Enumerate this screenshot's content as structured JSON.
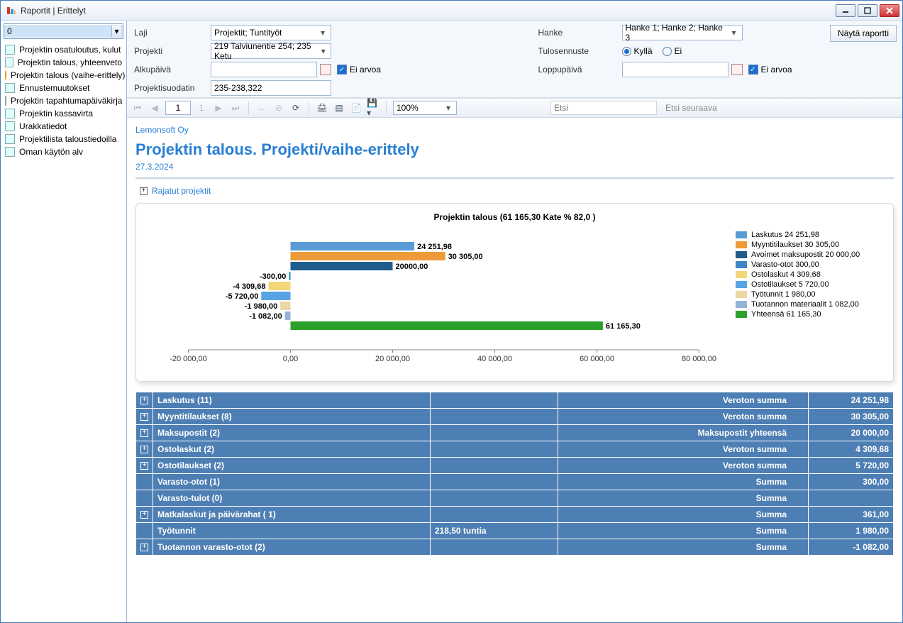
{
  "window": {
    "title": "Raportit | Erittelyt"
  },
  "sidebar": {
    "filter_value": "0",
    "items": [
      {
        "label": "Projektin osatuloutus, kulut",
        "sel": false,
        "ic": "doc"
      },
      {
        "label": "Projektin talous, yhteenveto",
        "sel": false,
        "ic": "doc"
      },
      {
        "label": "Projektin talous (vaihe-erittely)",
        "sel": true,
        "ic": "orange"
      },
      {
        "label": "Ennustemuutokset",
        "sel": false,
        "ic": "doc"
      },
      {
        "label": "Projektin tapahtumapäiväkirja",
        "sel": false,
        "ic": "doc"
      },
      {
        "label": "Projektin kassavirta",
        "sel": false,
        "ic": "doc"
      },
      {
        "label": "Urakkatiedot",
        "sel": false,
        "ic": "doc"
      },
      {
        "label": "Projektilista taloustiedoilla",
        "sel": false,
        "ic": "doc"
      },
      {
        "label": "Oman käytön alv",
        "sel": false,
        "ic": "doc"
      }
    ]
  },
  "filters": {
    "labels": {
      "laji": "Laji",
      "projekti": "Projekti",
      "alku": "Alkupäivä",
      "loppu": "Loppupäivä",
      "hanke": "Hanke",
      "tulos": "Tulosennuste",
      "suodatin": "Projektisuodatin",
      "eiarvoa": "Ei arvoa",
      "kylla": "Kyllä",
      "ei": "Ei",
      "show": "Näytä raportti"
    },
    "laji_value": "Projektit; Tuntityöt",
    "projekti_value": "219 Talviunentie 254; 235 Ketu",
    "hanke_value": "Hanke 1; Hanke 2; Hanke 3",
    "suodatin_value": "235-238,322",
    "alku_value": "",
    "loppu_value": "",
    "tulos_selected": "kylla"
  },
  "toolbar": {
    "page": "1",
    "pages": "1",
    "zoom": "100%",
    "find_ph": "Etsi",
    "findnext": "Etsi seuraava"
  },
  "report": {
    "company": "Lemonsoft Oy",
    "title": "Projektin talous. Projekti/vaihe-erittely",
    "date": "27.3.2024",
    "rajatut": "Rajatut projektit"
  },
  "chart_data": {
    "type": "bar",
    "title": "Projektin talous (61 165,30 Kate % 82,0 )",
    "x_ticks": [
      "-20 000,00",
      "0,00",
      "20 000,00",
      "40 000,00",
      "60 000,00",
      "80 000,00"
    ],
    "x_min": -20000,
    "x_max": 80000,
    "series": [
      {
        "name": "Laskutus 24 251,98",
        "value": 24251.98,
        "color": "#5b9bd5",
        "label": "24 251,98"
      },
      {
        "name": "Myyntitilaukset 30 305,00",
        "value": 30305.0,
        "color": "#ed9b38",
        "label": "30 305,00"
      },
      {
        "name": "Avoimet maksupostit 20 000,00",
        "value": 20000.0,
        "color": "#1f5c8b",
        "label": "20000,00"
      },
      {
        "name": "Varasto-otot 300,00",
        "value": -300.0,
        "color": "#3a88c4",
        "label": "-300,00"
      },
      {
        "name": "Ostolaskut 4 309,68",
        "value": -4309.68,
        "color": "#f3d67a",
        "label": "-4 309,68"
      },
      {
        "name": "Ostotilaukset 5 720,00",
        "value": -5720.0,
        "color": "#57a3e4",
        "label": "-5 720,00"
      },
      {
        "name": "Työtunnit 1 980,00",
        "value": -1980.0,
        "color": "#e9d7a6",
        "label": "-1 980,00"
      },
      {
        "name": "Tuotannon materiaalit 1 082,00",
        "value": -1082.0,
        "color": "#94b3d6",
        "label": "-1 082,00"
      },
      {
        "name": "Yhteensä 61 165,30",
        "value": 61165.3,
        "color": "#2ca02c",
        "label": "61 165,30"
      }
    ]
  },
  "summary": {
    "rows": [
      {
        "exp": true,
        "name": "Laskutus (11)",
        "mid": "Veroton summa",
        "val": "24 251,98"
      },
      {
        "exp": true,
        "name": "Myyntitilaukset (8)",
        "mid": "Veroton summa",
        "val": "30 305,00"
      },
      {
        "exp": true,
        "name": "Maksupostit (2)",
        "mid": "Maksupostit yhteensä",
        "val": "20 000,00"
      },
      {
        "exp": true,
        "name": "Ostolaskut (2)",
        "mid": "Veroton summa",
        "val": "4 309,68"
      },
      {
        "exp": true,
        "name": "Ostotilaukset (2)",
        "mid": "Veroton summa",
        "val": "5 720,00"
      },
      {
        "exp": false,
        "name": "Varasto-otot (1)",
        "mid": "Summa",
        "val": "300,00"
      },
      {
        "exp": false,
        "name": "Varasto-tulot (0)",
        "mid": "Summa",
        "val": ""
      },
      {
        "exp": true,
        "name": "Matkalaskut ja päivärahat ( 1)",
        "mid": "Summa",
        "val": "361,00"
      },
      {
        "exp": false,
        "name": "Työtunnit",
        "hours": "218,50  tuntia",
        "mid": "Summa",
        "val": "1 980,00"
      },
      {
        "exp": true,
        "name": "Tuotannon varasto-otot (2)",
        "mid": "Summa",
        "val": "-1 082,00"
      }
    ]
  }
}
